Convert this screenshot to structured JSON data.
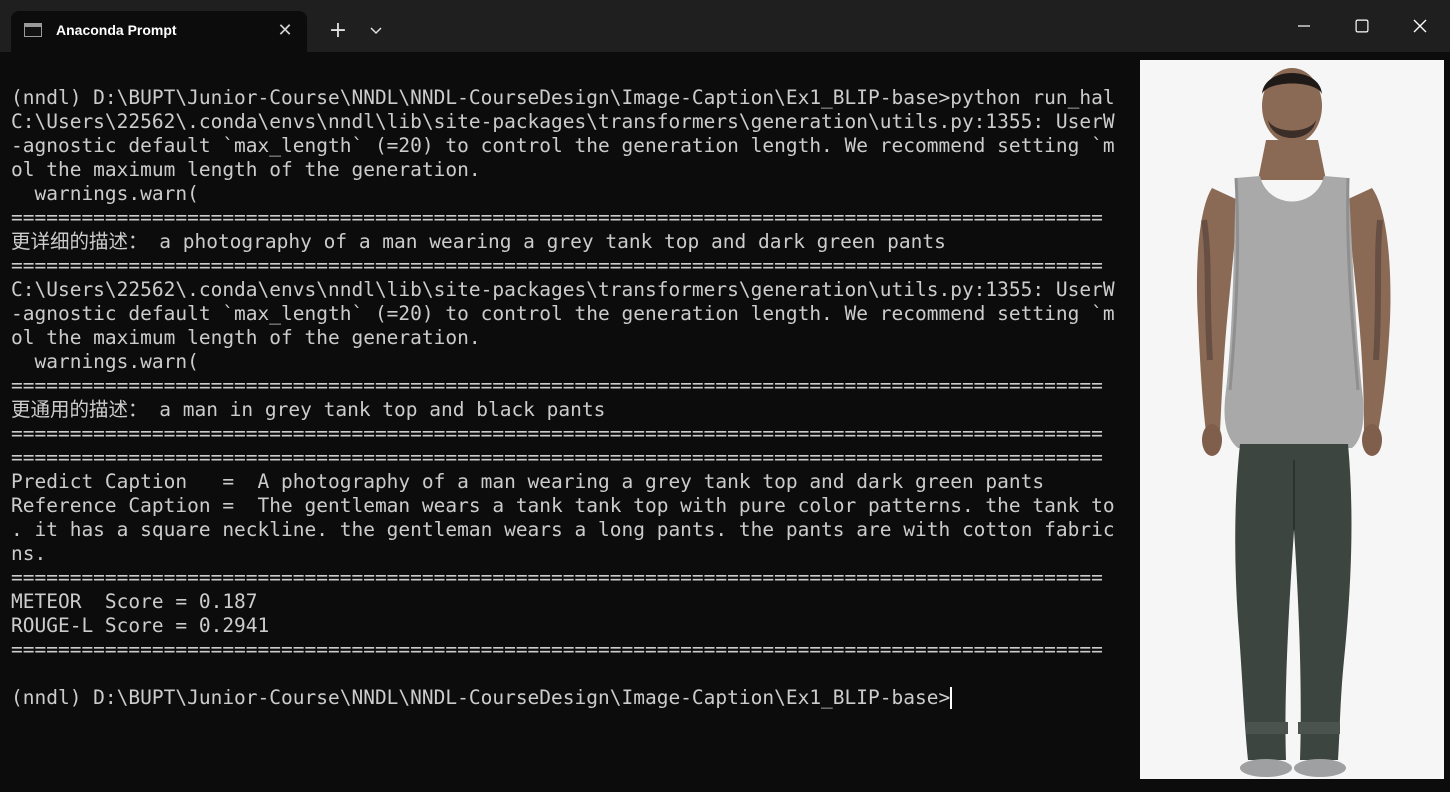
{
  "window": {
    "tab_title": "Anaconda Prompt",
    "tab_close": "✕",
    "new_tab": "+"
  },
  "terminal": {
    "lines": [
      "(nndl) D:\\BUPT\\Junior-Course\\NNDL\\NNDL-CourseDesign\\Image-Caption\\Ex1_BLIP-base>python run_hal",
      "C:\\Users\\22562\\.conda\\envs\\nndl\\lib\\site-packages\\transformers\\generation\\utils.py:1355: UserW",
      "-agnostic default `max_length` (=20) to control the generation length. We recommend setting `m",
      "ol the maximum length of the generation.",
      "  warnings.warn(",
      "=============================================================================================",
      "更详细的描述： a photography of a man wearing a grey tank top and dark green pants",
      "=============================================================================================",
      "C:\\Users\\22562\\.conda\\envs\\nndl\\lib\\site-packages\\transformers\\generation\\utils.py:1355: UserW",
      "-agnostic default `max_length` (=20) to control the generation length. We recommend setting `m",
      "ol the maximum length of the generation.",
      "  warnings.warn(",
      "=============================================================================================",
      "更通用的描述： a man in grey tank top and black pants",
      "=============================================================================================",
      "=============================================================================================",
      "Predict Caption   =  A photography of a man wearing a grey tank top and dark green pants",
      "Reference Caption =  The gentleman wears a tank tank top with pure color patterns. the tank to",
      ". it has a square neckline. the gentleman wears a long pants. the pants are with cotton fabric",
      "ns.",
      "=============================================================================================",
      "METEOR  Score = 0.187",
      "ROUGE-L Score = 0.2941",
      "=============================================================================================",
      "",
      "(nndl) D:\\BUPT\\Junior-Course\\NNDL\\NNDL-CourseDesign\\Image-Caption\\Ex1_BLIP-base>"
    ]
  },
  "colors": {
    "terminal_bg": "#0c0c0c",
    "terminal_text": "#cccccc",
    "titlebar_bg": "#1f1f1f"
  },
  "icons": {
    "tab": "terminal-icon",
    "dropdown": "chevron-down-icon",
    "minimize": "minimize-icon",
    "maximize": "maximize-icon",
    "close": "close-icon"
  }
}
